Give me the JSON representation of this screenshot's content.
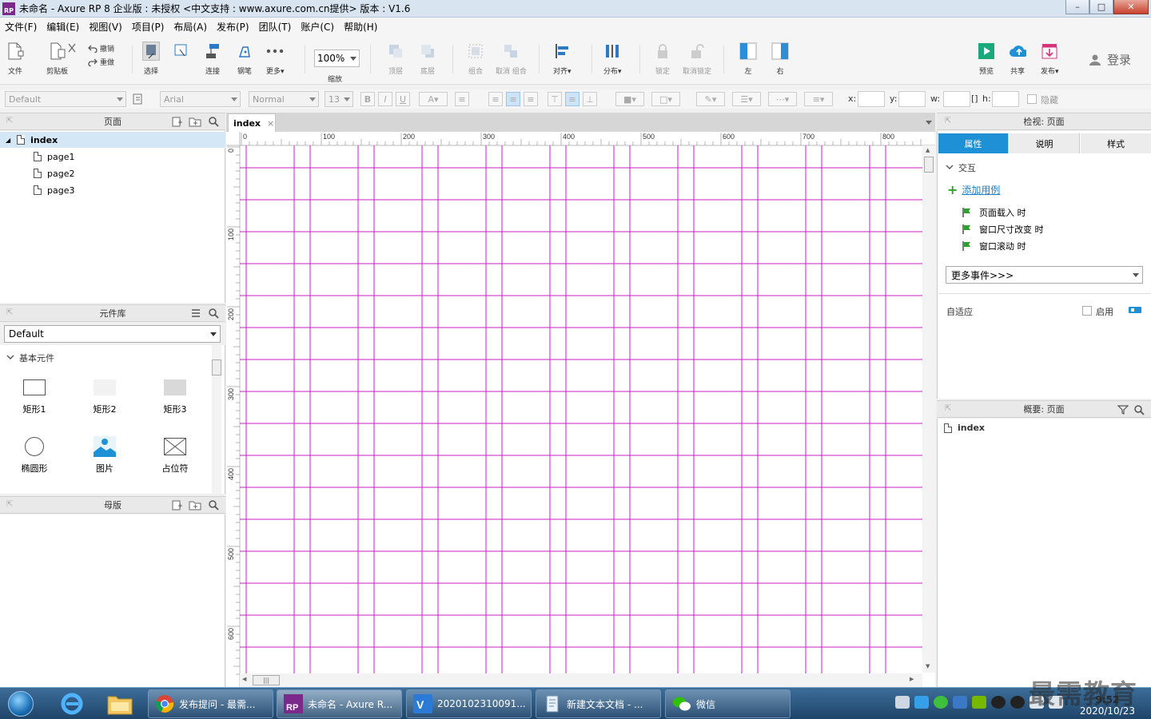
{
  "window": {
    "title": "未命名 - Axure RP 8 企业版 : 未授权      <中文支持 : www.axure.com.cn提供> 版本 : V1.6",
    "app_icon": "RP"
  },
  "menubar": [
    "文件(F)",
    "编辑(E)",
    "视图(V)",
    "项目(P)",
    "布局(A)",
    "发布(P)",
    "团队(T)",
    "账户(C)",
    "帮助(H)"
  ],
  "toolbar": {
    "file": "文件",
    "clipboard": "剪贴板",
    "undo": "撤销",
    "redo": "重做",
    "select": "选择",
    "connect": "连接",
    "pen": "钢笔",
    "more": "更多▾",
    "zoom_value": "100%",
    "zoom": "缩放",
    "front": "顶层",
    "back": "底层",
    "group": "组合",
    "ungroup": "取消 组合",
    "align": "对齐▾",
    "distribute": "分布▾",
    "lock": "锁定",
    "unlock": "取消锁定",
    "left": "左",
    "right": "右",
    "preview": "预览",
    "share": "共享",
    "publish": "发布▾",
    "login": "登录"
  },
  "formatbar": {
    "style_value": "Default",
    "font_value": "Arial",
    "weight_value": "Normal",
    "size_value": "13",
    "bold": "B",
    "italic": "I",
    "underline": "U",
    "x_label": "x:",
    "y_label": "y:",
    "w_label": "w:",
    "h_label": "h:",
    "hidden": "隐藏"
  },
  "pages_panel": {
    "title": "页面",
    "pages": [
      {
        "name": "index"
      },
      {
        "name": "page1"
      },
      {
        "name": "page2"
      },
      {
        "name": "page3"
      }
    ]
  },
  "library_panel": {
    "title": "元件库",
    "selected_library": "Default",
    "section": "基本元件",
    "widgets": [
      {
        "label": "矩形1"
      },
      {
        "label": "矩形2"
      },
      {
        "label": "矩形3"
      },
      {
        "label": "椭圆形"
      },
      {
        "label": "图片"
      },
      {
        "label": "占位符"
      }
    ]
  },
  "masters_panel": {
    "title": "母版"
  },
  "canvas": {
    "tab_label": "index",
    "tab_close": "×",
    "ruler_x": [
      "0",
      "100",
      "200",
      "300",
      "400",
      "500",
      "600",
      "700",
      "800"
    ],
    "ruler_y": [
      "0",
      "100",
      "200",
      "300",
      "400",
      "500",
      "600"
    ],
    "grid_color": "#c81ec8"
  },
  "inspector": {
    "title": "检视: 页面",
    "tabs": [
      "属性",
      "说明",
      "样式"
    ],
    "interaction_section": "交互",
    "add_case": "添加用例",
    "events": [
      "页面载入 时",
      "窗口尺寸改变 时",
      "窗口滚动 时"
    ],
    "more_events": "更多事件>>>",
    "adaptive_label": "自适应",
    "enable_label": "启用",
    "accent_color": "#1e90d6"
  },
  "outline": {
    "title": "概要: 页面",
    "root": "index"
  },
  "taskbar": {
    "tasks": [
      {
        "label": "发布提问 - 最需..."
      },
      {
        "label": "未命名 - Axure R..."
      },
      {
        "label": "2020102310091..."
      },
      {
        "label": "新建文本文档 - ..."
      },
      {
        "label": "微信"
      }
    ],
    "time": "9:52",
    "date": "2020/10/23"
  },
  "watermark": "最需教育"
}
